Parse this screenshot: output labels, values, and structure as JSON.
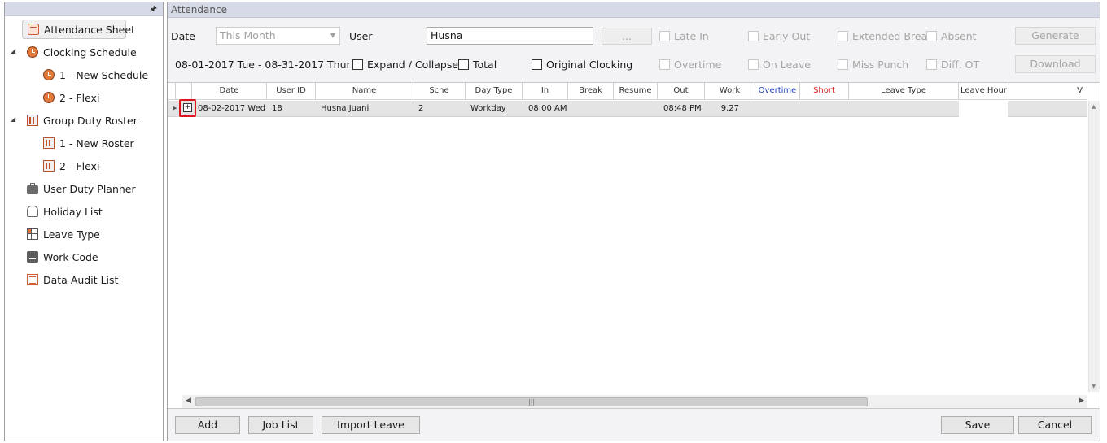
{
  "nav": {
    "items": [
      {
        "label": "Attendance Sheet",
        "icon": "attendance-sheet-icon"
      },
      {
        "label": "Clocking Schedule",
        "icon": "clock-icon"
      },
      {
        "label": "1 - New Schedule",
        "icon": "clock-icon"
      },
      {
        "label": "2 - Flexi",
        "icon": "clock-icon"
      },
      {
        "label": "Group Duty Roster",
        "icon": "roster-icon"
      },
      {
        "label": "1 - New Roster",
        "icon": "roster-icon"
      },
      {
        "label": "2 - Flexi",
        "icon": "roster-icon"
      },
      {
        "label": "User Duty Planner",
        "icon": "briefcase-icon"
      },
      {
        "label": "Holiday List",
        "icon": "flip-flops-icon"
      },
      {
        "label": "Leave Type",
        "icon": "grid-icon"
      },
      {
        "label": "Work Code",
        "icon": "code-icon"
      },
      {
        "label": "Data Audit List",
        "icon": "audit-list-icon"
      }
    ],
    "expander_symbol": "◢",
    "pin_symbol": "🖈"
  },
  "main": {
    "title": "Attendance",
    "date_label": "Date",
    "date_value": "This Month",
    "user_label": "User",
    "user_value": "Husna",
    "browse_label": "...",
    "range_text": "08-01-2017 Tue - 08-31-2017 Thur",
    "filters_row1": [
      "Late In",
      "Early Out",
      "Extended Break",
      "Absent"
    ],
    "filters_row2": [
      "Overtime",
      "On Leave",
      "Miss Punch",
      "Diff. OT"
    ],
    "options": [
      "Expand / Collapse",
      "Total",
      "Original Clocking"
    ],
    "generate_label": "Generate",
    "download_label": "Download"
  },
  "grid": {
    "columns": [
      "Date",
      "User ID",
      "Name",
      "Sche",
      "Day Type",
      "In",
      "Break",
      "Resume",
      "Out",
      "Work",
      "Overtime",
      "Short",
      "Leave Type",
      "Leave Hour",
      "V"
    ],
    "column_colors": {
      "Overtime": "#1f3fbf",
      "Short": "#d61a1a"
    },
    "rows": [
      {
        "date": "08-02-2017  Wed",
        "user_id": "18",
        "name": "Husna Juani",
        "sche": "2",
        "day_type": "Workday",
        "in": "08:00 AM",
        "break": "",
        "resume": "",
        "out": "08:48 PM",
        "work": "9.27",
        "overtime": "",
        "short": "",
        "leave_type": "",
        "leave_hour": ""
      }
    ]
  },
  "footer": {
    "add_label": "Add",
    "job_list_label": "Job List",
    "import_leave_label": "Import Leave",
    "save_label": "Save",
    "cancel_label": "Cancel"
  }
}
